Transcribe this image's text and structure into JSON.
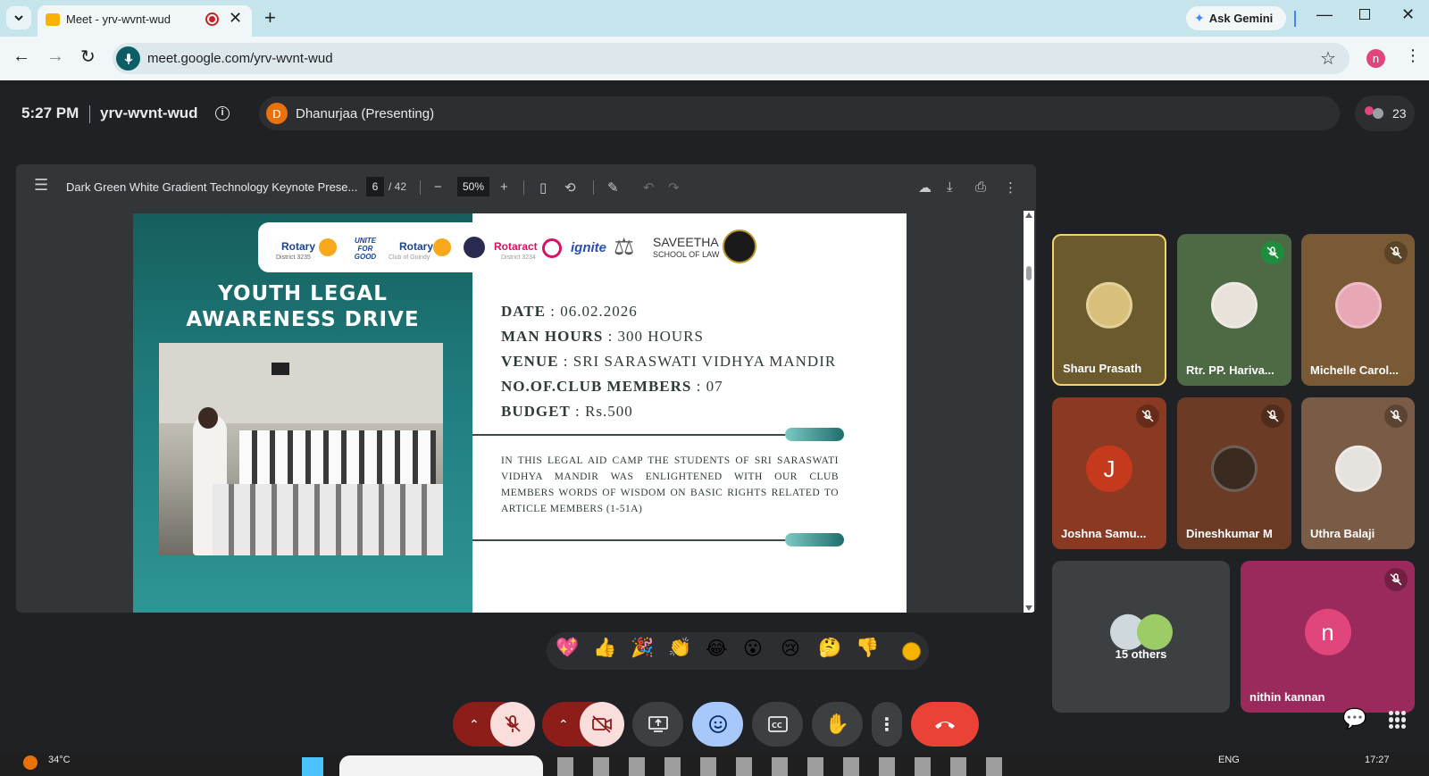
{
  "browser": {
    "tab_title": "Meet - yrv-wvnt-wud",
    "url": "meet.google.com/yrv-wvnt-wud",
    "ask_gemini": "Ask Gemini",
    "profile_initial": "n"
  },
  "meet": {
    "time": "5:27 PM",
    "meeting_code": "yrv-wvnt-wud",
    "presenter_initial": "D",
    "presenter_label": "Dhanurjaa (Presenting)",
    "participant_count": "23"
  },
  "pdf": {
    "title": "Dark Green White Gradient Technology Keynote Prese...",
    "page": "6",
    "total_pages": "/ 42",
    "zoom": "50%"
  },
  "slide": {
    "heading_line1": "YOUTH LEGAL",
    "heading_line2": "AWARENESS DRIVE",
    "logos": {
      "rotary1": "Rotary",
      "rotary1_sub": "District 3235",
      "unite": "UNITE FOR GOOD",
      "rotary2": "Rotary",
      "rotary2_sub": "Club of Guindy",
      "rotaract": "Rotaract",
      "rotaract_sub": "District 3234",
      "ignite": "ignite",
      "saveetha": "SAVEETHA",
      "saveetha_sub": "SCHOOL OF LAW"
    },
    "date_label": "DATE",
    "date_value": ": 06.02.2026",
    "hours_label": "MAN HOURS",
    "hours_value": ": 300 HOURS",
    "venue_label": "VENUE",
    "venue_value": ": SRI SARASWATI VIDHYA MANDIR",
    "members_label": "NO.OF.CLUB MEMBERS",
    "members_value": ": 07",
    "budget_label": "BUDGET",
    "budget_value": ": Rs.500",
    "description": "IN THIS LEGAL AID CAMP THE STUDENTS OF SRI SARASWATI VIDHYA MANDIR WAS ENLIGHTENED WITH OUR CLUB MEMBERS WORDS OF WISDOM ON BASIC RIGHTS RELATED TO ARTICLE MEMBERS (1-51A)"
  },
  "participants": [
    {
      "name": "Sharu Prasath",
      "bg": "#6b5a2e",
      "muted": false
    },
    {
      "name": "Rtr. PP. Hariva...",
      "bg": "#4d6a45",
      "muted": true
    },
    {
      "name": "Michelle Carol...",
      "bg": "#7a5a35",
      "muted": true
    },
    {
      "name": "Joshna Samu...",
      "bg": "#8a3a22",
      "muted": true,
      "initial": "J"
    },
    {
      "name": "Dineshkumar M",
      "bg": "#6b3b26",
      "muted": true
    },
    {
      "name": "Uthra Balaji",
      "bg": "#7a5b46",
      "muted": true
    },
    {
      "name": "15 others",
      "bg": "#3c4043"
    },
    {
      "name": "nithin kannan",
      "bg": "#9a2a5b",
      "muted": true,
      "initial": "n"
    }
  ],
  "reactions": [
    "💖",
    "👍",
    "🎉",
    "👏",
    "😂",
    "😮",
    "😢",
    "🤔",
    "👎"
  ],
  "taskbar": {
    "weather": "34°C",
    "lang": "ENG",
    "clock": "17:27"
  },
  "colors": {
    "accent_blue": "#8ab4f8",
    "end_call_red": "#ea4335",
    "muted_red": "#f9dedc",
    "teal": "#2d8a8a"
  }
}
